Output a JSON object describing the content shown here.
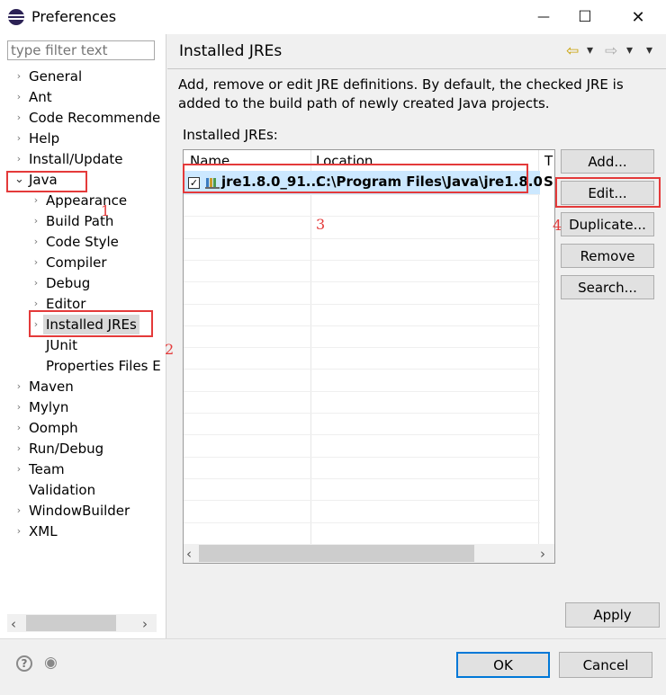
{
  "window": {
    "title": "Preferences",
    "minimize_glyph": "—",
    "maximize_glyph": "☐",
    "close_glyph": "✕"
  },
  "filter": {
    "placeholder": "type filter text"
  },
  "tree": {
    "items": [
      {
        "label": "General",
        "level": 0,
        "chevron": "›"
      },
      {
        "label": "Ant",
        "level": 0,
        "chevron": "›"
      },
      {
        "label": "Code Recommende",
        "level": 0,
        "chevron": "›"
      },
      {
        "label": "Help",
        "level": 0,
        "chevron": "›"
      },
      {
        "label": "Install/Update",
        "level": 0,
        "chevron": "›"
      },
      {
        "label": "Java",
        "level": 0,
        "chevron": "⌄",
        "expanded": true
      },
      {
        "label": "Appearance",
        "level": 1,
        "chevron": "›"
      },
      {
        "label": "Build Path",
        "level": 1,
        "chevron": "›"
      },
      {
        "label": "Code Style",
        "level": 1,
        "chevron": "›"
      },
      {
        "label": "Compiler",
        "level": 1,
        "chevron": "›"
      },
      {
        "label": "Debug",
        "level": 1,
        "chevron": "›"
      },
      {
        "label": "Editor",
        "level": 1,
        "chevron": "›"
      },
      {
        "label": "Installed JREs",
        "level": 1,
        "chevron": "›",
        "selected": true
      },
      {
        "label": "JUnit",
        "level": 1,
        "chevron": ""
      },
      {
        "label": "Properties Files E",
        "level": 1,
        "chevron": ""
      },
      {
        "label": "Maven",
        "level": 0,
        "chevron": "›"
      },
      {
        "label": "Mylyn",
        "level": 0,
        "chevron": "›"
      },
      {
        "label": "Oomph",
        "level": 0,
        "chevron": "›"
      },
      {
        "label": "Run/Debug",
        "level": 0,
        "chevron": "›"
      },
      {
        "label": "Team",
        "level": 0,
        "chevron": "›"
      },
      {
        "label": "Validation",
        "level": 0,
        "chevron": ""
      },
      {
        "label": "WindowBuilder",
        "level": 0,
        "chevron": "›"
      },
      {
        "label": "XML",
        "level": 0,
        "chevron": "›"
      }
    ],
    "scroll_left": "‹",
    "scroll_right": "›"
  },
  "page": {
    "title": "Installed JREs",
    "description": "Add, remove or edit JRE definitions. By default, the checked JRE is added to the build path of newly created Java projects.",
    "list_label": "Installed JREs:",
    "nav": {
      "back_icon": "⇦",
      "forward_icon": "⇨",
      "dropdown_glyph": "▾"
    }
  },
  "table": {
    "columns": [
      "Name",
      "Location",
      "T"
    ],
    "rows": [
      {
        "checked": true,
        "check_glyph": "✓",
        "name": "jre1.8.0_91...",
        "location": "C:\\Program Files\\Java\\jre1.8.0",
        "type": "S"
      }
    ],
    "scroll_left": "‹",
    "scroll_right": "›"
  },
  "buttons": {
    "add": "Add...",
    "edit": "Edit...",
    "duplicate": "Duplicate...",
    "remove": "Remove",
    "search": "Search...",
    "apply": "Apply",
    "ok": "OK",
    "cancel": "Cancel"
  },
  "footer": {
    "help_glyph": "?",
    "import_glyph": "◉"
  },
  "annotations": [
    "1",
    "2",
    "3",
    "4"
  ],
  "colors": {
    "annotation": "#e43a3a",
    "selection": "#cce8ff",
    "default_button_border": "#0078d7"
  }
}
